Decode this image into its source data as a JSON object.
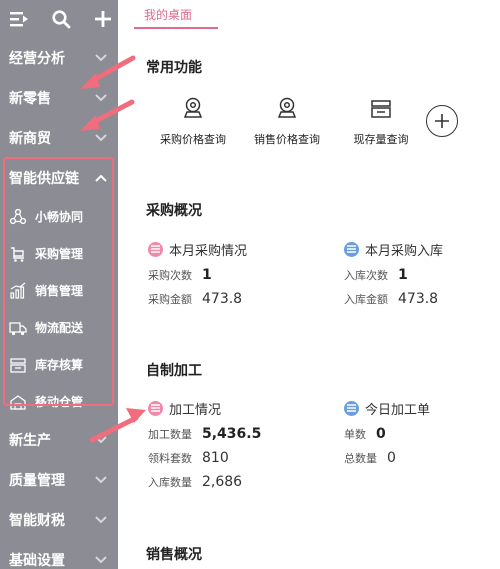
{
  "sidebar": {
    "items_top": [
      {
        "label": "经营分析"
      },
      {
        "label": "新零售"
      },
      {
        "label": "新商贸"
      },
      {
        "label": "智能供应链"
      }
    ],
    "sub_items": [
      {
        "label": "小畅协同",
        "icon": "collab-icon"
      },
      {
        "label": "采购管理",
        "icon": "cart-icon"
      },
      {
        "label": "销售管理",
        "icon": "sales-chart-icon"
      },
      {
        "label": "物流配送",
        "icon": "truck-icon"
      },
      {
        "label": "库存核算",
        "icon": "inventory-icon"
      },
      {
        "label": "移动仓管",
        "icon": "warehouse-icon"
      }
    ],
    "items_bottom": [
      {
        "label": "新生产"
      },
      {
        "label": "质量管理"
      },
      {
        "label": "智能财税"
      },
      {
        "label": "基础设置"
      }
    ]
  },
  "main": {
    "tab": "我的桌面",
    "common": {
      "title": "常用功能",
      "items": [
        {
          "label": "采购价格查询",
          "icon": "price-tag-icon"
        },
        {
          "label": "销售价格查询",
          "icon": "price-tag-icon"
        },
        {
          "label": "现存量查询",
          "icon": "stock-icon"
        }
      ]
    },
    "purchase": {
      "title": "采购概况",
      "left": {
        "title": "本月采购情况",
        "rows": [
          {
            "k": "采购次数",
            "v": "1"
          },
          {
            "k": "采购金额",
            "v": "473.8"
          }
        ]
      },
      "right": {
        "title": "本月采购入库",
        "rows": [
          {
            "k": "入库次数",
            "v": "1"
          },
          {
            "k": "入库金额",
            "v": "473.8"
          }
        ]
      }
    },
    "process": {
      "title": "自制加工",
      "left": {
        "title": "加工情况",
        "rows": [
          {
            "k": "加工数量",
            "v": "5,436.5"
          },
          {
            "k": "领料套数",
            "v": "810"
          },
          {
            "k": "入库数量",
            "v": "2,686"
          }
        ]
      },
      "right": {
        "title": "今日加工单",
        "rows": [
          {
            "k": "单数",
            "v": "0"
          },
          {
            "k": "总数量",
            "v": "0"
          }
        ]
      }
    },
    "sales": {
      "title": "销售概况"
    }
  },
  "colors": {
    "sidebar_bg": "#8b8c94",
    "accent_pink": "#e16b8c",
    "annotation_red": "#f06d7e",
    "badge_pink": "#f08aa8",
    "badge_blue": "#6d9edc"
  }
}
